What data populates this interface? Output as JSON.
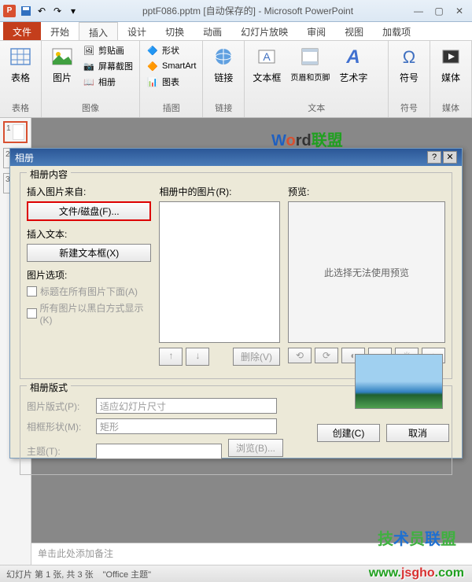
{
  "window": {
    "title": "pptF086.pptm [自动保存的] - Microsoft PowerPoint"
  },
  "tabs": {
    "file": "文件",
    "home": "开始",
    "insert": "插入",
    "design": "设计",
    "transition": "切换",
    "animation": "动画",
    "slideshow": "幻灯片放映",
    "review": "审阅",
    "view": "视图",
    "addins": "加载项"
  },
  "ribbon": {
    "tables": {
      "label": "表格",
      "button": "表格"
    },
    "images": {
      "label": "图像",
      "picture": "图片",
      "clipart": "剪贴画",
      "screenshot": "屏幕截图",
      "album": "相册"
    },
    "illustrations": {
      "label": "插图",
      "shapes": "形状",
      "smartart": "SmartArt",
      "chart": "图表"
    },
    "links": {
      "label": "链接",
      "button": "链接"
    },
    "text": {
      "label": "文本",
      "textbox": "文本框",
      "headerfooter": "页眉和页脚",
      "wordart": "艺术字"
    },
    "symbols": {
      "label": "符号",
      "button": "符号"
    },
    "media": {
      "label": "媒体",
      "button": "媒体"
    }
  },
  "dialog": {
    "title": "相册",
    "content_section": "相册内容",
    "insert_from": "插入图片来自:",
    "file_disk": "文件/磁盘(F)...",
    "insert_text": "插入文本:",
    "new_textbox": "新建文本框(X)",
    "options": "图片选项:",
    "caption_below": "标题在所有图片下面(A)",
    "black_white": "所有图片以黑白方式显示(K)",
    "pics_in_album": "相册中的图片(R):",
    "preview": "预览:",
    "preview_empty": "此选择无法使用预览",
    "move_up": "↑",
    "move_down": "↓",
    "delete": "删除(V)",
    "layout_section": "相册版式",
    "pic_layout": "图片版式(P):",
    "pic_layout_val": "适应幻灯片尺寸",
    "frame_shape": "相框形状(M):",
    "frame_shape_val": "矩形",
    "theme": "主题(T):",
    "browse": "浏览(B)...",
    "create": "创建(C)",
    "cancel": "取消"
  },
  "notes": {
    "placeholder": "单击此处添加备注"
  },
  "status": {
    "slide": "幻灯片 第 1 张, 共 3 张",
    "theme": "\"Office 主题\""
  }
}
